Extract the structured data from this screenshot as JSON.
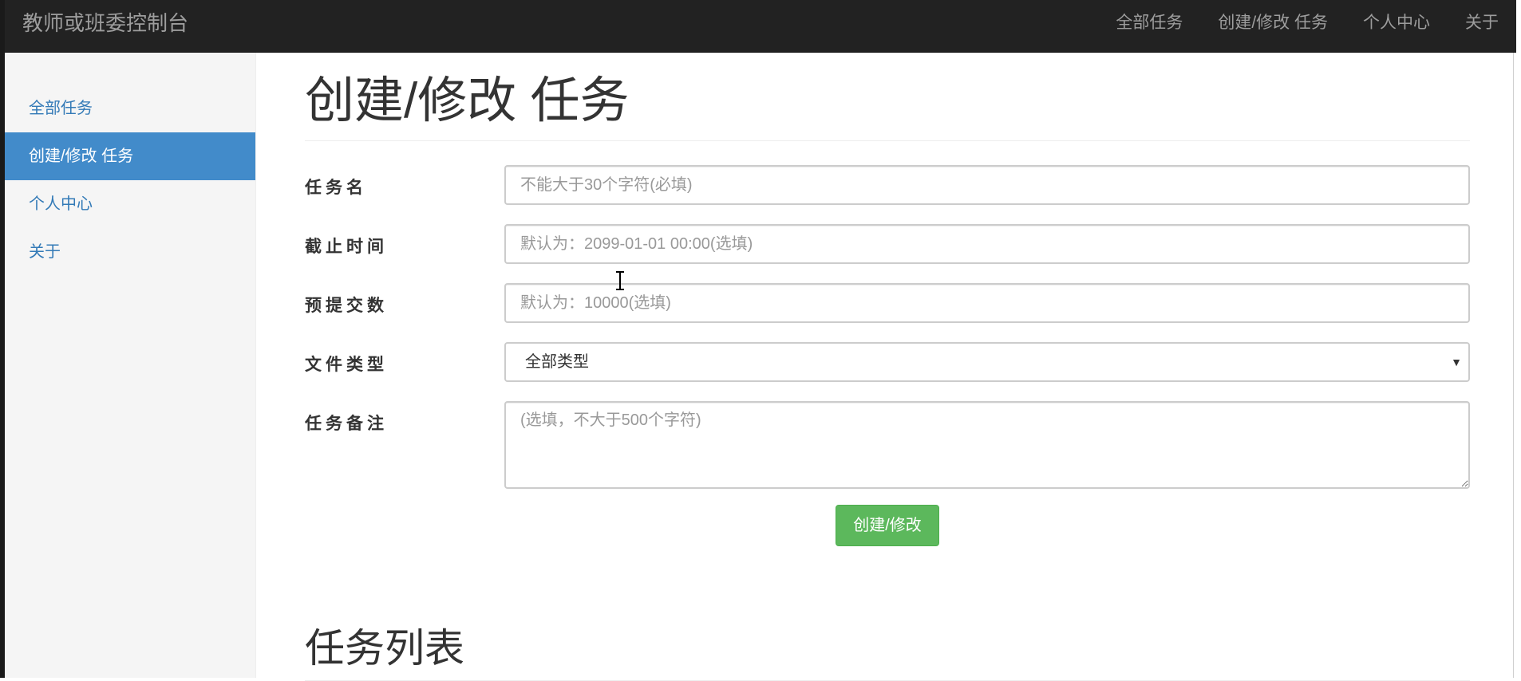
{
  "navbar": {
    "brand": "教师或班委控制台",
    "links": [
      "全部任务",
      "创建/修改 任务",
      "个人中心",
      "关于"
    ]
  },
  "sidebar": {
    "items": [
      {
        "label": "全部任务",
        "active": false
      },
      {
        "label": "创建/修改 任务",
        "active": true
      },
      {
        "label": "个人中心",
        "active": false
      },
      {
        "label": "关于",
        "active": false
      }
    ]
  },
  "main": {
    "title": "创建/修改 任务",
    "form": {
      "task_name": {
        "label": "任务名",
        "placeholder": "不能大于30个字符(必填)",
        "value": ""
      },
      "deadline": {
        "label": "截止时间",
        "placeholder": "默认为：2099-01-01 00:00(选填)",
        "value": ""
      },
      "expected_count": {
        "label": "预提交数",
        "placeholder": "默认为：10000(选填)",
        "value": ""
      },
      "file_type": {
        "label": "文件类型",
        "selected": "全部类型"
      },
      "remark": {
        "label": "任务备注",
        "placeholder": "(选填，不大于500个字符)",
        "value": ""
      },
      "submit_label": "创建/修改"
    },
    "list_title": "任务列表"
  },
  "colors": {
    "navbar_bg": "#222222",
    "sidebar_active": "#428bca",
    "link": "#337ab7",
    "success": "#5cb85c"
  }
}
